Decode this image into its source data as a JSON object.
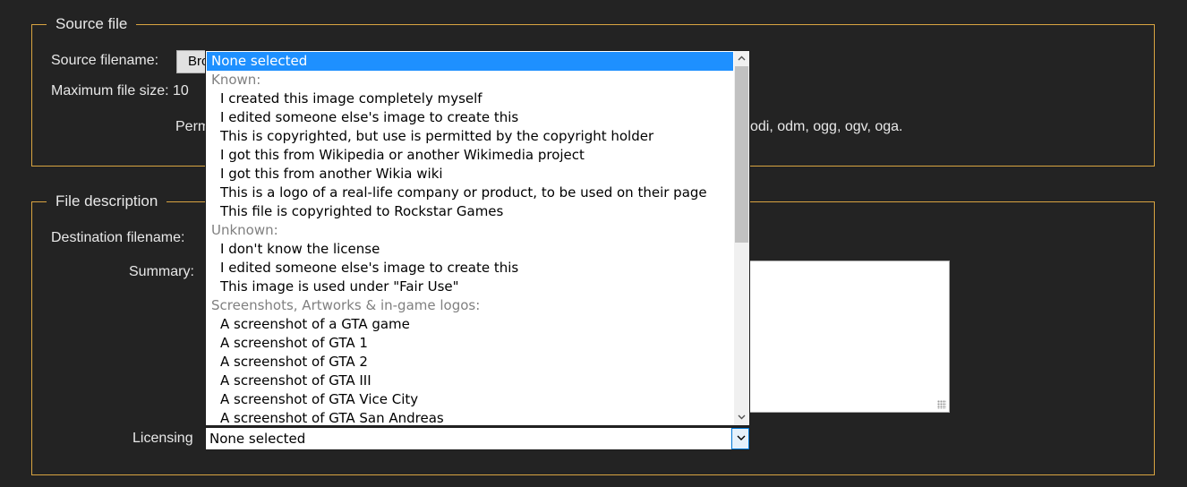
{
  "source_section": {
    "legend": "Source file",
    "source_filename_label": "Source filename:",
    "browse_label": "Browse...",
    "max_size_text": "Maximum file size: 10",
    "permitted_text_start": "Perm",
    "permitted_text_end": "odi, odm, ogg, ogv, oga."
  },
  "description_section": {
    "legend": "File description",
    "destination_label": "Destination filename:",
    "summary_label": "Summary:",
    "licensing_label": "Licensing"
  },
  "licensing_select": {
    "value": "None selected",
    "options": [
      {
        "label": "None selected",
        "kind": "selected"
      },
      {
        "label": "Known:",
        "kind": "group"
      },
      {
        "label": "I created this image completely myself",
        "kind": "option"
      },
      {
        "label": "I edited someone else's image to create this",
        "kind": "option"
      },
      {
        "label": "This is copyrighted, but use is permitted by the copyright holder",
        "kind": "option"
      },
      {
        "label": "I got this from Wikipedia or another Wikimedia project",
        "kind": "option"
      },
      {
        "label": "I got this from another Wikia wiki",
        "kind": "option"
      },
      {
        "label": "This is a logo of a real-life company or product, to be used on their page",
        "kind": "option"
      },
      {
        "label": "This file is copyrighted to Rockstar Games",
        "kind": "option"
      },
      {
        "label": "Unknown:",
        "kind": "group"
      },
      {
        "label": "I don't know the license",
        "kind": "option"
      },
      {
        "label": "I edited someone else's image to create this",
        "kind": "option"
      },
      {
        "label": "This image is used under \"Fair Use\"",
        "kind": "option"
      },
      {
        "label": "Screenshots, Artworks & in-game logos:",
        "kind": "group"
      },
      {
        "label": "A screenshot of a GTA game",
        "kind": "option"
      },
      {
        "label": "A screenshot of GTA 1",
        "kind": "option"
      },
      {
        "label": "A screenshot of GTA 2",
        "kind": "option"
      },
      {
        "label": "A screenshot of GTA III",
        "kind": "option"
      },
      {
        "label": "A screenshot of GTA Vice City",
        "kind": "option"
      },
      {
        "label": "A screenshot of GTA San Andreas",
        "kind": "option"
      }
    ]
  },
  "colors": {
    "background": "#232323",
    "fieldset_border": "#d9a441",
    "selection": "#1e90ff",
    "group_text": "#808080"
  }
}
